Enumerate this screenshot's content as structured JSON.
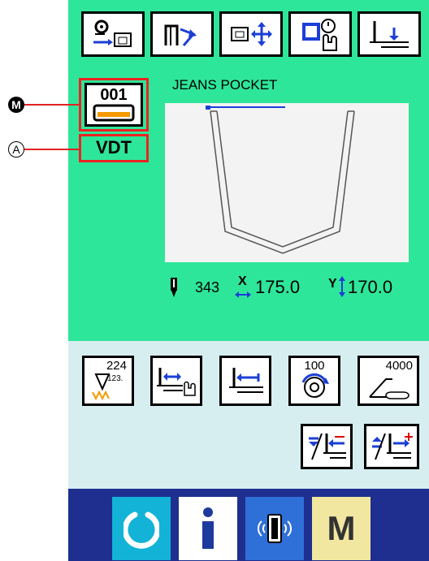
{
  "pattern": {
    "number": "001",
    "material_code": "VDT",
    "name": "JEANS POCKET"
  },
  "stats": {
    "stitch_count": "343",
    "x_label": "X",
    "x_value": "175.0",
    "y_label": "Y",
    "y_value": "170.0"
  },
  "mid_buttons": {
    "counter_value": "224",
    "counter_sub": "123.",
    "speed_value": "100",
    "speed_max": "4000"
  },
  "callouts": {
    "m": "M",
    "a": "A"
  },
  "colors": {
    "panel_green": "#2ee69a",
    "panel_light": "#d7eef0",
    "panel_dark": "#1e2f8f",
    "outline_red": "#e22222"
  }
}
